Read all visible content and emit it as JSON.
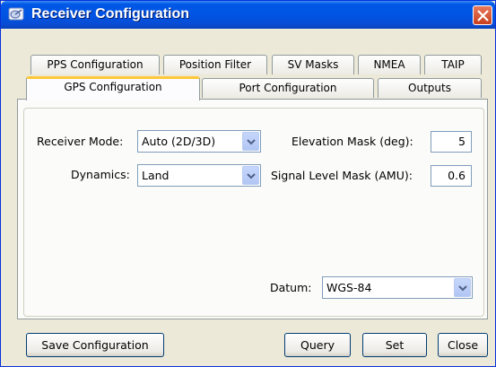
{
  "window": {
    "title": "Receiver Configuration"
  },
  "tabs": {
    "row1": [
      "PPS Configuration",
      "Position Filter",
      "SV Masks",
      "NMEA",
      "TAIP"
    ],
    "row2": [
      "GPS Configuration",
      "Port Configuration",
      "Outputs"
    ],
    "selected": "GPS Configuration"
  },
  "gps": {
    "receiver_mode_label": "Receiver Mode:",
    "receiver_mode_value": "Auto (2D/3D)",
    "dynamics_label": "Dynamics:",
    "dynamics_value": "Land",
    "elevation_mask_label": "Elevation Mask (deg):",
    "elevation_mask_value": "5",
    "signal_level_label": "Signal Level Mask (AMU):",
    "signal_level_value": "0.6",
    "datum_label": "Datum:",
    "datum_value": "WGS-84"
  },
  "buttons": {
    "save": "Save Configuration",
    "query": "Query",
    "set": "Set",
    "close": "Close"
  },
  "icons": {
    "app": "satellite-dish-icon",
    "close": "close-x-icon",
    "dropdown": "chevron-down-icon"
  }
}
